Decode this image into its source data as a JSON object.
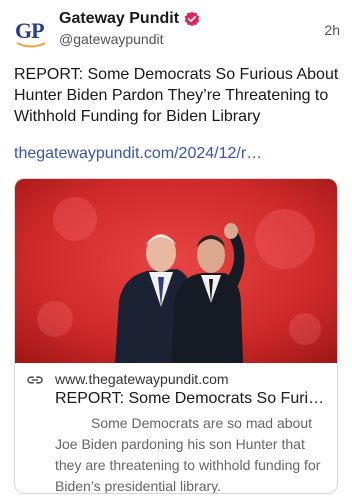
{
  "header": {
    "logo_text": "GP",
    "author_name": "Gateway Pundit",
    "handle": "@gatewaypundit",
    "timestamp": "2h"
  },
  "post": {
    "text": "REPORT: Some Democrats So Furious About Hunter Biden Pardon They’re Threatening to Withhold Funding for Biden Library",
    "link": "thegatewaypundit.com/2024/12/r…"
  },
  "card": {
    "domain": "www.thegatewaypundit.com",
    "title": "REPORT: Some Democrats So Furious…",
    "description": "Some Democrats are so mad about Joe Biden pardoning his son Hunter that they are threatening to withhold funding for Biden’s presidential library."
  },
  "colors": {
    "link": "#3656b8",
    "verified": "#e0255a",
    "logo": "#233e8b",
    "image_background": "#d42a2a"
  },
  "icons": [
    "verified-badge-icon",
    "link-icon"
  ]
}
